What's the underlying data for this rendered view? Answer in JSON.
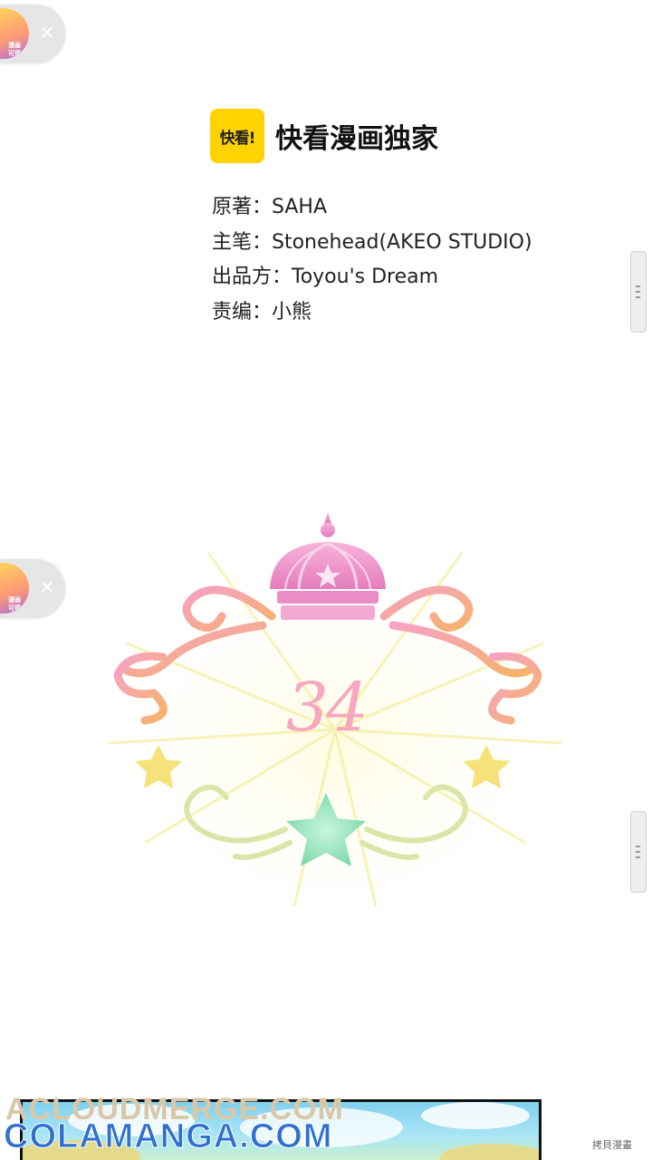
{
  "floating_badges": [
    {
      "line1": "漫画",
      "line2": "可得",
      "close_icon": "close-icon"
    },
    {
      "line1": "漫画",
      "line2": "可得",
      "close_icon": "close-icon"
    }
  ],
  "logo": {
    "mark": "快看!",
    "text": "快看漫画独家",
    "color": "#ffd200"
  },
  "credits": [
    "原著：SAHA",
    "主笔：Stonehead(AKEO STUDIO)",
    "出品方：Toyou's Dream",
    "责编：小熊"
  ],
  "chapter": {
    "number": "34",
    "color": "#f7a8be"
  },
  "watermark": {
    "line1": "ACLOUDMERGE.COM",
    "line2": "COLAMANGA.COM"
  },
  "corner_tag": "拷貝漫畫"
}
